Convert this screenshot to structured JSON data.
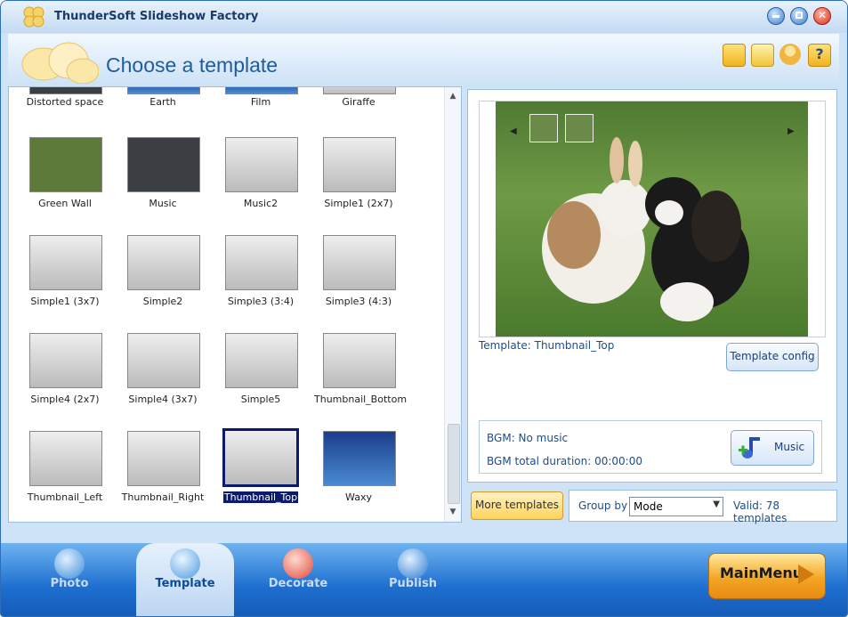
{
  "app": {
    "title": "ThunderSoft Slideshow Factory"
  },
  "header": {
    "title": "Choose a template"
  },
  "templates": [
    {
      "name": "Distorted space"
    },
    {
      "name": "Earth"
    },
    {
      "name": "Film"
    },
    {
      "name": "Giraffe"
    },
    {
      "name": "Green Wall"
    },
    {
      "name": "Music"
    },
    {
      "name": "Music2"
    },
    {
      "name": "Simple1 (2x7)"
    },
    {
      "name": "Simple1 (3x7)"
    },
    {
      "name": "Simple2"
    },
    {
      "name": "Simple3 (3:4)"
    },
    {
      "name": "Simple3 (4:3)"
    },
    {
      "name": "Simple4 (2x7)"
    },
    {
      "name": "Simple4 (3x7)"
    },
    {
      "name": "Simple5"
    },
    {
      "name": "Thumbnail_Bottom"
    },
    {
      "name": "Thumbnail_Left"
    },
    {
      "name": "Thumbnail_Right"
    },
    {
      "name": "Thumbnail_Top",
      "selected": true
    },
    {
      "name": "Waxy"
    }
  ],
  "preview": {
    "template_label": "Template:  Thumbnail_Top",
    "config_button": "Template config",
    "bgm_label": "BGM: No music",
    "bgm_duration": "BGM total duration: 00:00:00",
    "music_button": "Music"
  },
  "bottom": {
    "more_templates": "More templates",
    "group_by_label": "Group by",
    "group_by_value": "Mode",
    "valid": "Valid: 78 templates"
  },
  "nav": {
    "photo": "Photo",
    "template": "Template",
    "decorate": "Decorate",
    "publish": "Publish",
    "main_menu": "MainMenu"
  }
}
